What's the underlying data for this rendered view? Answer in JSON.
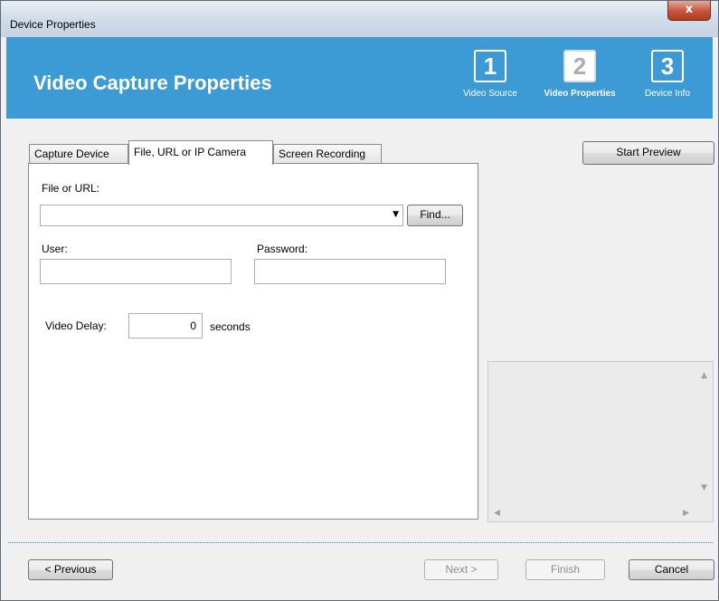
{
  "window": {
    "title": "Device Properties",
    "close_label": "x"
  },
  "header": {
    "title": "Video Capture Properties",
    "steps": [
      {
        "number": "1",
        "label": "Video Source"
      },
      {
        "number": "2",
        "label": "Video Properties"
      },
      {
        "number": "3",
        "label": "Device Info"
      }
    ]
  },
  "tabs": [
    {
      "label": "Capture Device"
    },
    {
      "label": "File, URL or IP Camera"
    },
    {
      "label": "Screen Recording"
    }
  ],
  "form": {
    "file_label": "File or URL:",
    "file_value": "",
    "dropdown_arrow": "▼",
    "find_button": "Find...",
    "user_label": "User:",
    "user_value": "",
    "password_label": "Password:",
    "password_value": "",
    "delay_label": "Video Delay:",
    "delay_value": "0",
    "delay_unit": "seconds"
  },
  "preview": {
    "start_button": "Start Preview"
  },
  "footer": {
    "previous": "< Previous",
    "next": "Next >",
    "finish": "Finish",
    "cancel": "Cancel"
  },
  "colors": {
    "header_bg": "#3c9ad4",
    "close_button": "#c6533b"
  }
}
